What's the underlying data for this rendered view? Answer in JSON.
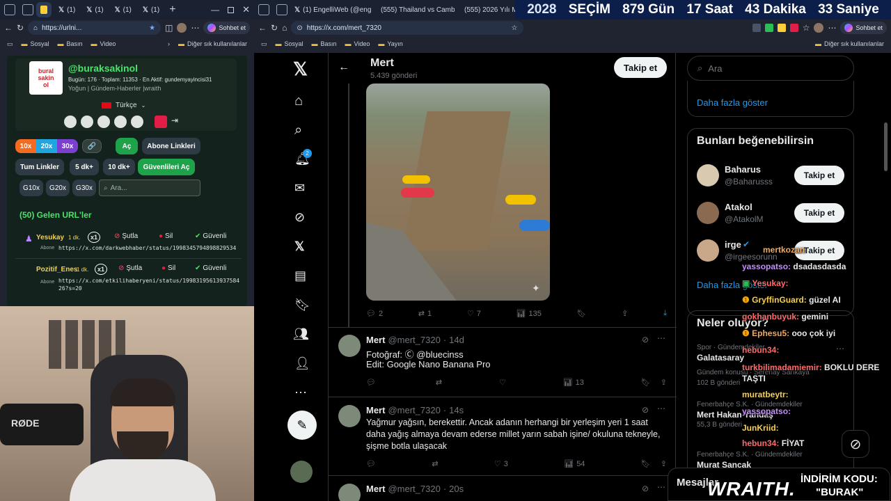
{
  "left_browser": {
    "tabs": [
      "(1)",
      "(1)",
      "(1)",
      "(1)"
    ],
    "url": "https://urlni...",
    "chat_button": "Sohbet et",
    "bookmarks": [
      "Sosyal",
      "Basın",
      "Video"
    ],
    "other_bookmarks": "Diğer sık kullanılanlar"
  },
  "panel": {
    "logo_text": "bural sakin ol",
    "username": "@buraksakinol",
    "stats": "Bugün: 176 · Toplam: 11353 · En Aktif: gundemyayincisi31",
    "subtitle": "Yoğun | Gündem-Haberler |wraith",
    "language": "Türkçe",
    "speed_buttons": [
      "10x",
      "20x",
      "30x"
    ],
    "open_button": "Aç",
    "subscriber_links": "Abone Linkleri",
    "all_links": "Tum Linkler",
    "five_plus": "5 dk+",
    "ten_plus": "10 dk+",
    "open_trusted": "Güvenlileri Aç",
    "g_buttons": [
      "G10x",
      "G20x",
      "G30x"
    ],
    "search_placeholder": "Ara...",
    "incoming_title": "(50) Gelen URL'ler",
    "url_items": [
      {
        "user": "Yesukay",
        "time": "1 dk.",
        "count": "x1",
        "tag": "Abone",
        "url": "https://x.com/darkwebhaber/status/1998345794898829534"
      },
      {
        "user": "Pozitif_Enes",
        "time": "1 dk.",
        "count": "x1",
        "tag": "Abone",
        "url": "https://x.com/etkilihaberyeni/status/1998319561393758426?s=20"
      }
    ],
    "action_labels": {
      "mute": "Şutla",
      "delete": "Sil",
      "trusted": "Güvenli"
    }
  },
  "right_browser": {
    "tabs": [
      "(1) EngelliWeb (@enge",
      "(555) Thailand vs Camb",
      "(555) 2026 Yılı Me"
    ],
    "url": "https://x.com/mert_7320",
    "chat_button": "Sohbet et",
    "bookmarks": [
      "Sosyal",
      "Basın",
      "Video",
      "Yayın"
    ],
    "other_bookmarks": "Diğer sık kullanılanlar"
  },
  "countdown": {
    "year": "2028",
    "label": "SEÇİM",
    "days": "879 Gün",
    "hours": "17 Saat",
    "minutes": "43 Dakika",
    "seconds": "33 Saniye"
  },
  "x_profile": {
    "name": "Mert",
    "posts": "5.439 gönderi",
    "follow": "Takip et",
    "notifications_badge": "2",
    "image_post_stats": {
      "replies": "2",
      "reposts": "1",
      "likes": "7",
      "views": "135"
    },
    "tweets": [
      {
        "name": "Mert",
        "handle": "@mert_7320",
        "time": "14d",
        "lines": [
          "Fotoğraf: Ⓒ @bluecinss",
          "Edit: Google Nano Banana Pro"
        ],
        "replies": "",
        "reposts": "",
        "likes": "",
        "views": "13"
      },
      {
        "name": "Mert",
        "handle": "@mert_7320",
        "time": "14s",
        "lines": [
          "Yağmur yağsın, berekettir. Ancak adanın herhangi bir yerleşim yeri 1 saat",
          "daha yağış almaya devam ederse millet yarın sabah işine/ okuluna tekneyle,",
          "şişme botla ulaşacak"
        ],
        "replies": "",
        "reposts": "",
        "likes": "3",
        "views": "54"
      },
      {
        "name": "Mert",
        "handle": "@mert_7320",
        "time": "20s",
        "lines": [],
        "replies": "",
        "reposts": "",
        "likes": "",
        "views": ""
      }
    ]
  },
  "sidebar": {
    "search_placeholder": "Ara",
    "show_more": "Daha fazla göster",
    "suggest_title": "Bunları beğenebilirsin",
    "suggestions": [
      {
        "name": "Baharus",
        "handle": "@Baharusss",
        "button": "Takip et"
      },
      {
        "name": "Atakol",
        "handle": "@AtakolM",
        "button": "Takip et"
      },
      {
        "name": "irge",
        "handle": "@irgeesorunn",
        "button": "Takip et"
      }
    ],
    "show_more2": "Daha fazla göster",
    "trends_title": "Neler oluyor?",
    "trends": [
      {
        "meta": "Spor · Gündemdekiler",
        "name": "Galatasaray",
        "extra": ""
      },
      {
        "meta": "Gündem konusu · Serenay Sarıkaya",
        "name": "",
        "extra": "102 B gönderi"
      },
      {
        "meta": "Fenerbahçe S.K. · Gündemdekiler",
        "name": "Mert Hakan Yandaş",
        "extra": "55,3 B gönderi"
      },
      {
        "meta": "Fenerbahçe S.K. · Gündemdekiler",
        "name": "Murat Sancak",
        "extra": ""
      }
    ],
    "messages": "Mesajlar"
  },
  "chat": [
    {
      "user": "mertkozan",
      "msg": "",
      "color": "#f0a95c"
    },
    {
      "user": "yassopatso:",
      "msg": "dsadasdasda",
      "color": "#c58cff"
    },
    {
      "user": "Yesukay:",
      "msg": "",
      "color": "#ff6b6b"
    },
    {
      "user": "GryffinGuard:",
      "msg": "güzel AI",
      "color": "#f6d04d"
    },
    {
      "user": "gokhanbuyuk:",
      "msg": "gemini",
      "color": "#ff6b6b"
    },
    {
      "user": "Ephesu5:",
      "msg": "ooo çok iyi",
      "color": "#f0a95c"
    },
    {
      "user": "hebun34:",
      "msg": "",
      "color": "#ff6b6b"
    },
    {
      "user": "turkbilimadamiemir:",
      "msg": "BOKLU DERE TAŞTI",
      "color": "#ff6b6b"
    },
    {
      "user": "muratbeytr:",
      "msg": "",
      "color": "#f6d04d"
    },
    {
      "user": "yassopatso:",
      "msg": "",
      "color": "#c58cff"
    },
    {
      "user": "JunKriid:",
      "msg": "",
      "color": "#f6d04d"
    },
    {
      "user": "hebun34:",
      "msg": "FİYAT",
      "color": "#ff6b6b"
    }
  ],
  "overlay": {
    "brand": "WRAITH.",
    "promo_title": "İNDİRİM KODU:",
    "promo_code": "\"BURAK\""
  }
}
